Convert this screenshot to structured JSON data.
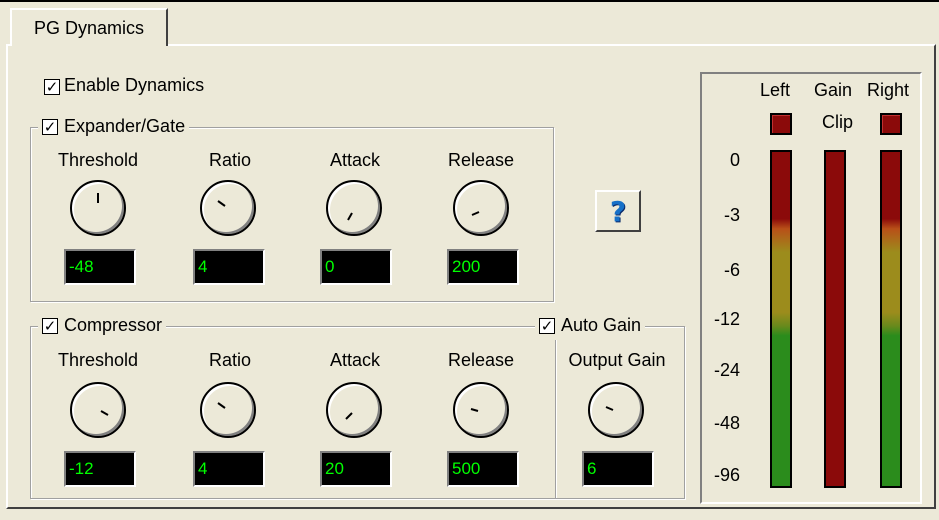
{
  "tab": {
    "label": "PG Dynamics"
  },
  "enable_dynamics": {
    "label": "Enable Dynamics",
    "checked": true
  },
  "expander": {
    "label": "Expander/Gate",
    "checked": true,
    "controls": [
      {
        "label": "Threshold",
        "value": "-48"
      },
      {
        "label": "Ratio",
        "value": "4"
      },
      {
        "label": "Attack",
        "value": "0"
      },
      {
        "label": "Release",
        "value": "200"
      }
    ]
  },
  "compressor": {
    "label": "Compressor",
    "checked": true,
    "controls": [
      {
        "label": "Threshold",
        "value": "-12"
      },
      {
        "label": "Ratio",
        "value": "4"
      },
      {
        "label": "Attack",
        "value": "20"
      },
      {
        "label": "Release",
        "value": "500"
      }
    ]
  },
  "auto_gain": {
    "label": "Auto Gain",
    "checked": true
  },
  "output_gain": {
    "label": "Output Gain",
    "value": "6"
  },
  "help_button": {
    "label": "?",
    "icon": "help-icon"
  },
  "meter": {
    "labels": {
      "left": "Left",
      "gain": "Gain",
      "right": "Right",
      "clip": "Clip"
    },
    "scale": [
      "0",
      "-3",
      "-6",
      "-12",
      "-24",
      "-48",
      "-96"
    ]
  },
  "colors": {
    "lcd_text": "#00ff00",
    "meter_red": "#8b0a0a",
    "meter_yellow": "#9c8c1c",
    "meter_green": "#2b8c1c",
    "help_blue": "#1670c8"
  }
}
